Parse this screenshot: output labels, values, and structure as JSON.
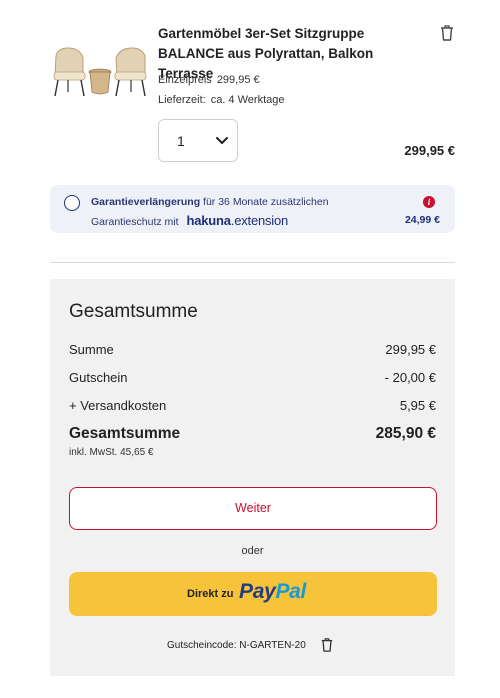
{
  "product": {
    "title": "Gartenmöbel 3er-Set Sitzgruppe BALANCE aus Polyrattan, Balkon Terrasse",
    "unit_price_label": "Einzelpreis",
    "unit_price": "299,95 €",
    "delivery_label": "Lieferzeit:",
    "delivery_value": "ca. 4 Werktage",
    "quantity": "1",
    "line_total": "299,95 €",
    "image_icon": "rattan-furniture-set-image",
    "delete_icon": "trash-icon"
  },
  "warranty": {
    "title_bold": "Garantieverlängerung",
    "title_rest": "für 36 Monate zusätzlichen",
    "line2": "Garantieschutz mit",
    "brand_bold": "hakuna",
    "brand_rest": ".extension",
    "price": "24,99 €",
    "info_glyph": "i",
    "accent_color": "#1f2f7a",
    "info_color": "#c8102e"
  },
  "summary": {
    "title": "Gesamtsumme",
    "rows": [
      {
        "label": "Summe",
        "value": "299,95 €"
      },
      {
        "label": "Gutschein",
        "value": "- 20,00 €"
      },
      {
        "label": "+ Versandkosten",
        "value": "5,95 €"
      }
    ],
    "total_label": "Gesamtsumme",
    "total_value": "285,90 €",
    "vat_note": "inkl. MwSt. 45,65 €",
    "continue_label": "Weiter",
    "or_label": "oder",
    "paypal_prefix": "Direkt zu",
    "paypal_pay": "Pay",
    "paypal_pal": "Pal",
    "coupon_text": "Gutscheincode: N-GARTEN-20",
    "brand_red": "#c8102e",
    "paypal_yellow": "#f7c33a"
  }
}
